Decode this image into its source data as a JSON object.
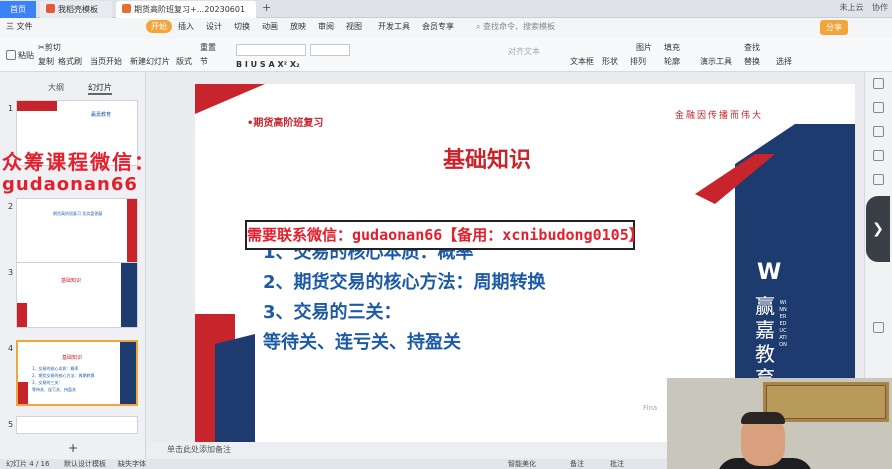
{
  "titlebar": {
    "tabs": [
      {
        "label": "首页"
      },
      {
        "label": "我稻壳模板"
      },
      {
        "label": "期货高阶班复习+...20230601"
      }
    ],
    "right": [
      "未上云",
      "协作",
      "分享"
    ]
  },
  "menubar": {
    "file": "三 文件",
    "items": [
      "开始",
      "插入",
      "设计",
      "切换",
      "动画",
      "放映",
      "审阅",
      "视图",
      "开发工具",
      "会员专享"
    ],
    "search_placeholder": "查找命令、搜索模板",
    "share": "分享"
  },
  "toolbar": {
    "items": [
      "粘贴",
      "剪切",
      "复制",
      "格式刷",
      "当页开始",
      "新建幻灯片",
      "版式",
      "节",
      "重置",
      "文本框",
      "形状",
      "排列",
      "轮廓",
      "演示工具",
      "替换",
      "选择",
      "查找",
      "图片",
      "填充"
    ],
    "font_placeholder": "对齐文本"
  },
  "leftpane": {
    "tab_outline": "大纲",
    "tab_slides": "幻灯片",
    "slide_numbers": [
      "1",
      "2",
      "3",
      "4",
      "5"
    ],
    "thumb1_brand": "赢嘉教育",
    "thumb2_title": "期货高阶班复习 及实盘答疑",
    "thumb3_title": "基础知识",
    "thumb4_title": "基础知识",
    "add_slide": "+"
  },
  "slide": {
    "tag": "•期货高阶班复习",
    "slogan": "金融因传播而伟大",
    "title": "基础知识",
    "lines": [
      "1、交易的核心本质：概率",
      "2、期货交易的核心方法：周期转换",
      "3、交易的三关：",
      "等待关、连亏关、持盈关"
    ],
    "logo_cn": "赢嘉教育",
    "logo_en": "WINNER EDUCATION",
    "footer": "Fina"
  },
  "overlay": {
    "watermark_line1": "众筹课程微信：",
    "watermark_line2": "gudaonan66",
    "banner": "需要联系微信：gudaonan66【备用：xcnibudong0105】"
  },
  "notes": {
    "placeholder": "单击此处添加备注"
  },
  "statusbar": {
    "slide_counter": "幻灯片 4 / 16",
    "theme": "默认设计模板",
    "font_missing": "缺失字体",
    "smart": "智能美化",
    "notes": "备注",
    "comments": "批注"
  },
  "colors": {
    "accent_red": "#c8242c",
    "accent_blue": "#1d3b6e",
    "text_blue": "#1d5aa6",
    "wps_orange": "#f2a53b"
  }
}
